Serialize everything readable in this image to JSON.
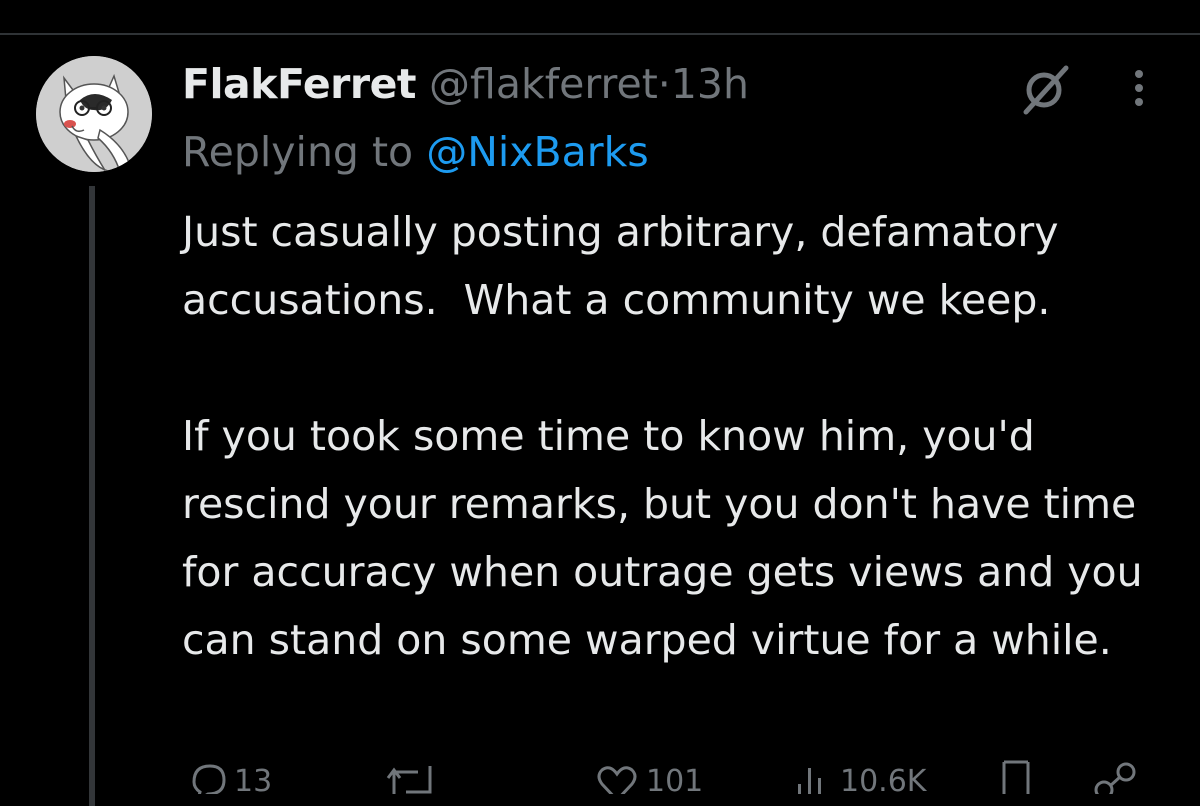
{
  "tweet": {
    "author_name": "FlakFerret",
    "handle": "@flakferret",
    "separator": "·",
    "time": "13h",
    "reply_prefix": "Replying to",
    "reply_to": "@NixBarks",
    "paragraphs": [
      "Just casually posting arbitrary, defamatory accusations.  What a community we keep.",
      "If you took some time to know him, you'd rescind your remarks, but you don't have time for accuracy when outrage gets views and you can stand on some warped virtue for a while."
    ]
  },
  "actions": {
    "replies": "13",
    "reposts": "",
    "likes": "101",
    "views": "10.6K"
  },
  "icons": {
    "avatar": "ferret-avatar",
    "grok": "grok-icon",
    "more": "more-options-icon",
    "reply": "reply-icon",
    "repost": "repost-icon",
    "like": "heart-icon",
    "views": "views-chart-icon",
    "bookmark": "bookmark-icon",
    "share": "share-icon"
  },
  "colors": {
    "background": "#000000",
    "text": "#e7e9ea",
    "muted": "#71767b",
    "accent": "#1d9bf0",
    "divider": "#2f3336"
  }
}
